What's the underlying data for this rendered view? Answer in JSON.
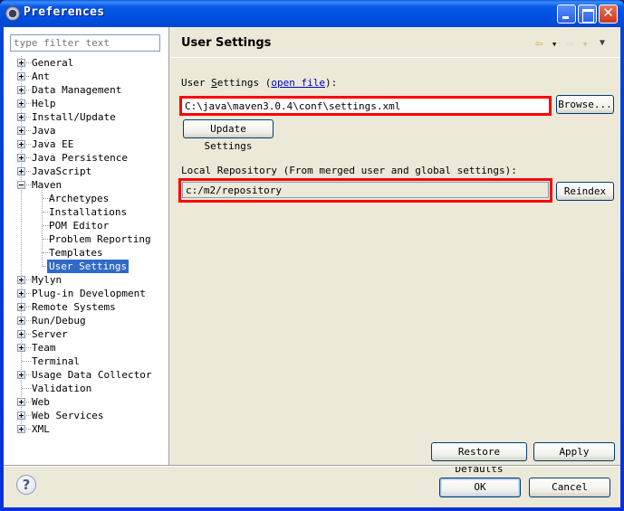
{
  "window": {
    "title": "Preferences",
    "controls": {
      "minimize": "minimize",
      "maximize": "maximize",
      "close": "✕"
    }
  },
  "sidebar": {
    "filter_placeholder": "type filter text",
    "items": [
      {
        "label": "General",
        "expandable": true,
        "expanded": false,
        "level": 0
      },
      {
        "label": "Ant",
        "expandable": true,
        "expanded": false,
        "level": 0
      },
      {
        "label": "Data Management",
        "expandable": true,
        "expanded": false,
        "level": 0
      },
      {
        "label": "Help",
        "expandable": true,
        "expanded": false,
        "level": 0
      },
      {
        "label": "Install/Update",
        "expandable": true,
        "expanded": false,
        "level": 0
      },
      {
        "label": "Java",
        "expandable": true,
        "expanded": false,
        "level": 0
      },
      {
        "label": "Java EE",
        "expandable": true,
        "expanded": false,
        "level": 0
      },
      {
        "label": "Java Persistence",
        "expandable": true,
        "expanded": false,
        "level": 0
      },
      {
        "label": "JavaScript",
        "expandable": true,
        "expanded": false,
        "level": 0
      },
      {
        "label": "Maven",
        "expandable": true,
        "expanded": true,
        "level": 0
      },
      {
        "label": "Archetypes",
        "expandable": false,
        "level": 1
      },
      {
        "label": "Installations",
        "expandable": false,
        "level": 1
      },
      {
        "label": "POM Editor",
        "expandable": false,
        "level": 1
      },
      {
        "label": "Problem Reporting",
        "expandable": false,
        "level": 1
      },
      {
        "label": "Templates",
        "expandable": false,
        "level": 1
      },
      {
        "label": "User Settings",
        "expandable": false,
        "level": 1,
        "selected": true
      },
      {
        "label": "Mylyn",
        "expandable": true,
        "expanded": false,
        "level": 0
      },
      {
        "label": "Plug-in Development",
        "expandable": true,
        "expanded": false,
        "level": 0
      },
      {
        "label": "Remote Systems",
        "expandable": true,
        "expanded": false,
        "level": 0
      },
      {
        "label": "Run/Debug",
        "expandable": true,
        "expanded": false,
        "level": 0
      },
      {
        "label": "Server",
        "expandable": true,
        "expanded": false,
        "level": 0
      },
      {
        "label": "Team",
        "expandable": true,
        "expanded": false,
        "level": 0
      },
      {
        "label": "Terminal",
        "expandable": false,
        "level": 0
      },
      {
        "label": "Usage Data Collector",
        "expandable": true,
        "expanded": false,
        "level": 0
      },
      {
        "label": "Validation",
        "expandable": false,
        "level": 0
      },
      {
        "label": "Web",
        "expandable": true,
        "expanded": false,
        "level": 0
      },
      {
        "label": "Web Services",
        "expandable": true,
        "expanded": false,
        "level": 0
      },
      {
        "label": "XML",
        "expandable": true,
        "expanded": false,
        "level": 0
      }
    ]
  },
  "page": {
    "title": "User Settings",
    "nav": {
      "back_icon": "⇦",
      "forward_icon": "⇨",
      "dropdown_icon": "▼"
    },
    "user_settings_label_pre": "User ",
    "user_settings_label_mnemonic": "S",
    "user_settings_label_post": "ettings (",
    "open_file_link": "open file",
    "user_settings_label_end": "):",
    "user_settings_value": "C:\\java\\maven3.0.4\\conf\\settings.xml",
    "browse_button": "Browse...",
    "update_settings_button": "Update Settings",
    "local_repo_label": "Local Repository (From merged user and global settings):",
    "local_repo_value": "c:/m2/repository",
    "reindex_button": "Reindex",
    "restore_defaults_button": "Restore Defaults",
    "apply_button": "Apply"
  },
  "footer": {
    "help_icon": "?",
    "ok_button": "OK",
    "cancel_button": "Cancel"
  },
  "colors": {
    "highlight_box": "#ff0000",
    "selection": "#316ac5",
    "titlebar": "#0058ee",
    "dialog_bg": "#ece9d8"
  }
}
